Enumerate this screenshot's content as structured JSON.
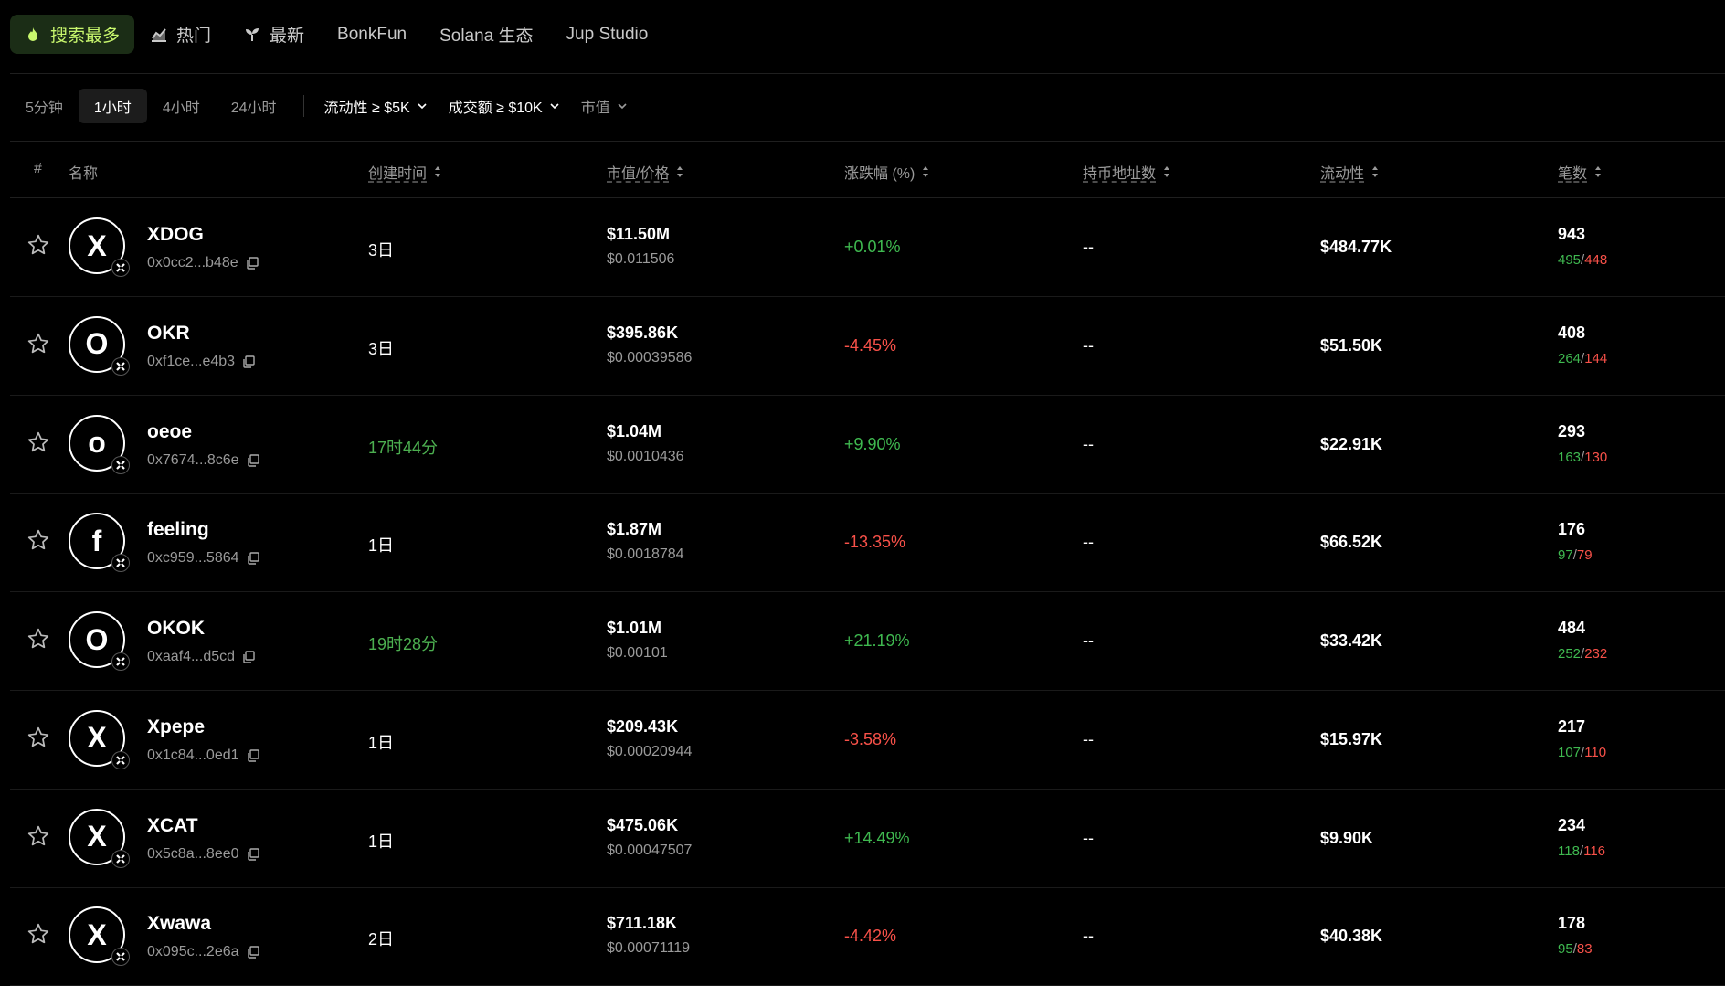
{
  "tabs": [
    {
      "label": "搜索最多",
      "icon": "flame-icon",
      "active": true
    },
    {
      "label": "热门",
      "icon": "chart-icon",
      "active": false
    },
    {
      "label": "最新",
      "icon": "sprout-icon",
      "active": false
    },
    {
      "label": "BonkFun",
      "icon": "",
      "active": false
    },
    {
      "label": "Solana 生态",
      "icon": "",
      "active": false
    },
    {
      "label": "Jup Studio",
      "icon": "",
      "active": false
    }
  ],
  "time_filters": [
    {
      "label": "5分钟",
      "active": false
    },
    {
      "label": "1小时",
      "active": true
    },
    {
      "label": "4小时",
      "active": false
    },
    {
      "label": "24小时",
      "active": false
    }
  ],
  "dropdowns": [
    {
      "label": "流动性 ≥ $5K"
    },
    {
      "label": "成交额 ≥ $10K"
    },
    {
      "label": "市值"
    }
  ],
  "columns": {
    "index": "#",
    "name": "名称",
    "created": "创建时间",
    "mcap": "市值/价格",
    "change": "涨跌幅 (%)",
    "holders": "持币地址数",
    "liquidity": "流动性",
    "txns": "笔数"
  },
  "colors": {
    "accent": "#c8f76d",
    "accent_bg": "#1b2d16",
    "positive": "#3fb950",
    "negative": "#f85149"
  },
  "rows": [
    {
      "letter": "X",
      "symbol": "XDOG",
      "address": "0x0cc2...b48e",
      "age": "3日",
      "age_recent": false,
      "mcap": "$11.50M",
      "price": "$0.011506",
      "change": "+0.01%",
      "dir": "pos",
      "holders": "--",
      "liquidity": "$484.77K",
      "txns": "943",
      "buys": "495",
      "sells": "448"
    },
    {
      "letter": "O",
      "symbol": "OKR",
      "address": "0xf1ce...e4b3",
      "age": "3日",
      "age_recent": false,
      "mcap": "$395.86K",
      "price": "$0.00039586",
      "change": "-4.45%",
      "dir": "neg",
      "holders": "--",
      "liquidity": "$51.50K",
      "txns": "408",
      "buys": "264",
      "sells": "144"
    },
    {
      "letter": "o",
      "symbol": "oeoe",
      "address": "0x7674...8c6e",
      "age": "17时44分",
      "age_recent": true,
      "mcap": "$1.04M",
      "price": "$0.0010436",
      "change": "+9.90%",
      "dir": "pos",
      "holders": "--",
      "liquidity": "$22.91K",
      "txns": "293",
      "buys": "163",
      "sells": "130"
    },
    {
      "letter": "f",
      "symbol": "feeling",
      "address": "0xc959...5864",
      "age": "1日",
      "age_recent": false,
      "mcap": "$1.87M",
      "price": "$0.0018784",
      "change": "-13.35%",
      "dir": "neg",
      "holders": "--",
      "liquidity": "$66.52K",
      "txns": "176",
      "buys": "97",
      "sells": "79"
    },
    {
      "letter": "O",
      "symbol": "OKOK",
      "address": "0xaaf4...d5cd",
      "age": "19时28分",
      "age_recent": true,
      "mcap": "$1.01M",
      "price": "$0.00101",
      "change": "+21.19%",
      "dir": "pos",
      "holders": "--",
      "liquidity": "$33.42K",
      "txns": "484",
      "buys": "252",
      "sells": "232"
    },
    {
      "letter": "X",
      "symbol": "Xpepe",
      "address": "0x1c84...0ed1",
      "age": "1日",
      "age_recent": false,
      "mcap": "$209.43K",
      "price": "$0.00020944",
      "change": "-3.58%",
      "dir": "neg",
      "holders": "--",
      "liquidity": "$15.97K",
      "txns": "217",
      "buys": "107",
      "sells": "110"
    },
    {
      "letter": "X",
      "symbol": "XCAT",
      "address": "0x5c8a...8ee0",
      "age": "1日",
      "age_recent": false,
      "mcap": "$475.06K",
      "price": "$0.00047507",
      "change": "+14.49%",
      "dir": "pos",
      "holders": "--",
      "liquidity": "$9.90K",
      "txns": "234",
      "buys": "118",
      "sells": "116"
    },
    {
      "letter": "X",
      "symbol": "Xwawa",
      "address": "0x095c...2e6a",
      "age": "2日",
      "age_recent": false,
      "mcap": "$711.18K",
      "price": "$0.00071119",
      "change": "-4.42%",
      "dir": "neg",
      "holders": "--",
      "liquidity": "$40.38K",
      "txns": "178",
      "buys": "95",
      "sells": "83"
    }
  ]
}
